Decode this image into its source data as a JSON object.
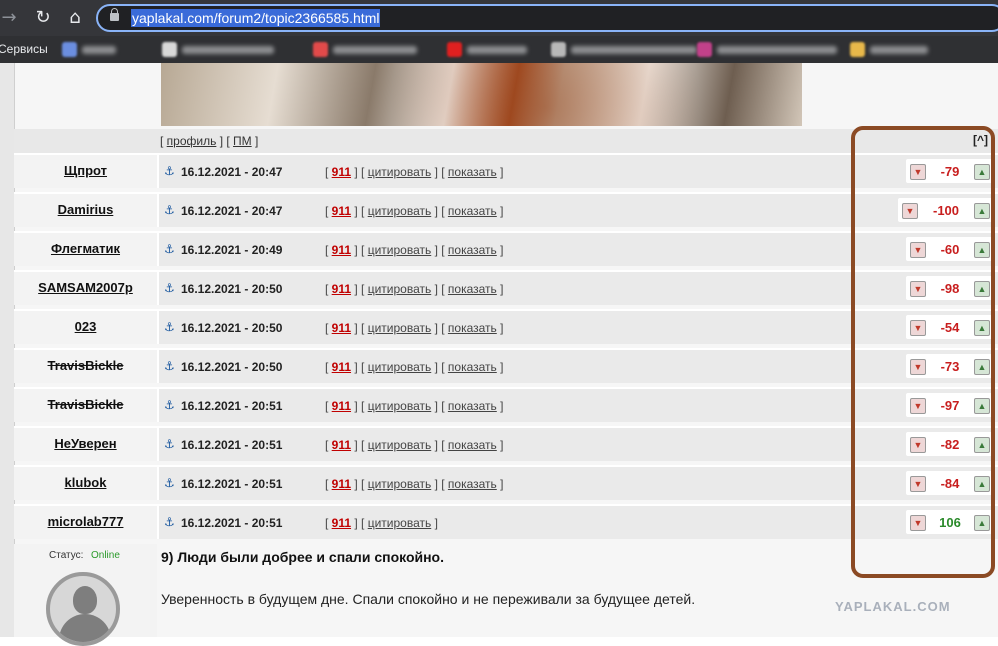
{
  "browser": {
    "nav": {
      "forward": "→",
      "reload": "↻",
      "home": "⌂"
    },
    "url": "yaplakal.com/forum2/topic2366585.html",
    "bookmarks_label": "Сервисы"
  },
  "profile_bar": {
    "profile": "профиль",
    "pm": "ПМ",
    "up": "[^]"
  },
  "posts": [
    {
      "author": "Щпрот",
      "date": "16.12.2021 - 20:47",
      "num": "911",
      "quote": "цитировать",
      "show": "показать",
      "rating": "-79"
    },
    {
      "author": "Damirius",
      "date": "16.12.2021 - 20:47",
      "num": "911",
      "quote": "цитировать",
      "show": "показать",
      "rating": "-100"
    },
    {
      "author": "Флегматик",
      "date": "16.12.2021 - 20:49",
      "num": "911",
      "quote": "цитировать",
      "show": "показать",
      "rating": "-60"
    },
    {
      "author": "SAMSAM2007p",
      "date": "16.12.2021 - 20:50",
      "num": "911",
      "quote": "цитировать",
      "show": "показать",
      "rating": "-98"
    },
    {
      "author": "023",
      "date": "16.12.2021 - 20:50",
      "num": "911",
      "quote": "цитировать",
      "show": "показать",
      "rating": "-54"
    },
    {
      "author": "TravisBickle",
      "date": "16.12.2021 - 20:50",
      "num": "911",
      "quote": "цитировать",
      "show": "показать",
      "rating": "-73"
    },
    {
      "author": "TravisBickle",
      "date": "16.12.2021 - 20:51",
      "num": "911",
      "quote": "цитировать",
      "show": "показать",
      "rating": "-97"
    },
    {
      "author": "НеУверен",
      "date": "16.12.2021 - 20:51",
      "num": "911",
      "quote": "цитировать",
      "show": "показать",
      "rating": "-82"
    },
    {
      "author": "klubok",
      "date": "16.12.2021 - 20:51",
      "num": "911",
      "quote": "цитировать",
      "show": "показать",
      "rating": "-84"
    },
    {
      "author": "microlab777",
      "date": "16.12.2021 - 20:51",
      "num": "911",
      "quote": "цитировать",
      "rating": "106"
    }
  ],
  "last_post": {
    "status_label": "Статус:",
    "status_value": "Online",
    "title": "9) Люди были добрее и спали спокойно.",
    "text": "Уверенность в будущем дне. Спали спокойно и не переживали за будущее детей."
  },
  "watermark": "YAPLAKAL.COM",
  "colors": {
    "negative": "#c81e1e",
    "positive": "#2a8a2a",
    "highlight": "#8b4a24",
    "link_red": "#c00000"
  },
  "icons": {
    "anchor": "⚓",
    "thumb_down": "thumbs-down-icon",
    "thumb_up": "thumbs-up-icon"
  }
}
